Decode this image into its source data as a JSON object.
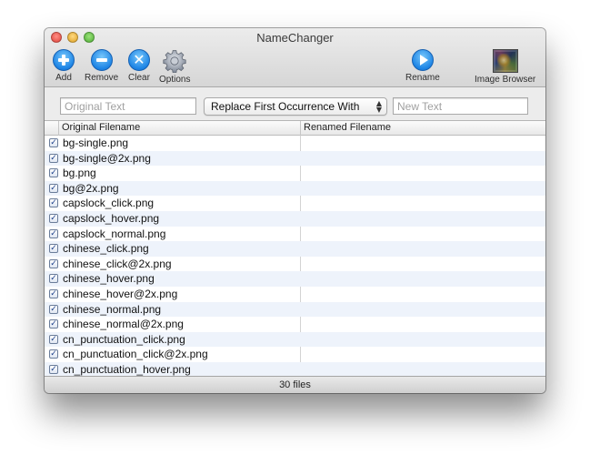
{
  "window": {
    "title": "NameChanger"
  },
  "toolbar": {
    "add_label": "Add",
    "remove_label": "Remove",
    "clear_label": "Clear",
    "options_label": "Options",
    "rename_label": "Rename",
    "image_browser_label": "Image Browser"
  },
  "replace_bar": {
    "original_placeholder": "Original Text",
    "original_value": "",
    "mode_selected": "Replace First Occurrence With",
    "new_placeholder": "New Text",
    "new_value": ""
  },
  "table": {
    "headers": {
      "original": "Original Filename",
      "renamed": "Renamed Filename"
    },
    "rows": [
      {
        "checked": true,
        "original": "bg-single.png",
        "renamed": ""
      },
      {
        "checked": true,
        "original": "bg-single@2x.png",
        "renamed": ""
      },
      {
        "checked": true,
        "original": "bg.png",
        "renamed": ""
      },
      {
        "checked": true,
        "original": "bg@2x.png",
        "renamed": ""
      },
      {
        "checked": true,
        "original": "capslock_click.png",
        "renamed": ""
      },
      {
        "checked": true,
        "original": "capslock_hover.png",
        "renamed": ""
      },
      {
        "checked": true,
        "original": "capslock_normal.png",
        "renamed": ""
      },
      {
        "checked": true,
        "original": "chinese_click.png",
        "renamed": ""
      },
      {
        "checked": true,
        "original": "chinese_click@2x.png",
        "renamed": ""
      },
      {
        "checked": true,
        "original": "chinese_hover.png",
        "renamed": ""
      },
      {
        "checked": true,
        "original": "chinese_hover@2x.png",
        "renamed": ""
      },
      {
        "checked": true,
        "original": "chinese_normal.png",
        "renamed": ""
      },
      {
        "checked": true,
        "original": "chinese_normal@2x.png",
        "renamed": ""
      },
      {
        "checked": true,
        "original": "cn_punctuation_click.png",
        "renamed": ""
      },
      {
        "checked": true,
        "original": "cn_punctuation_click@2x.png",
        "renamed": ""
      },
      {
        "checked": true,
        "original": "cn_punctuation_hover.png",
        "renamed": ""
      }
    ]
  },
  "status": {
    "text": "30 files"
  },
  "icons": {
    "add": "plus-circle-icon",
    "remove": "minus-circle-icon",
    "clear": "x-circle-icon",
    "options": "gear-icon",
    "rename": "play-circle-icon",
    "image_browser": "image-thumbnail-icon",
    "checkbox": "checkbox-checked-icon"
  },
  "colors": {
    "accent_blue": "#1d84e5",
    "row_alt": "#eef3fb"
  }
}
